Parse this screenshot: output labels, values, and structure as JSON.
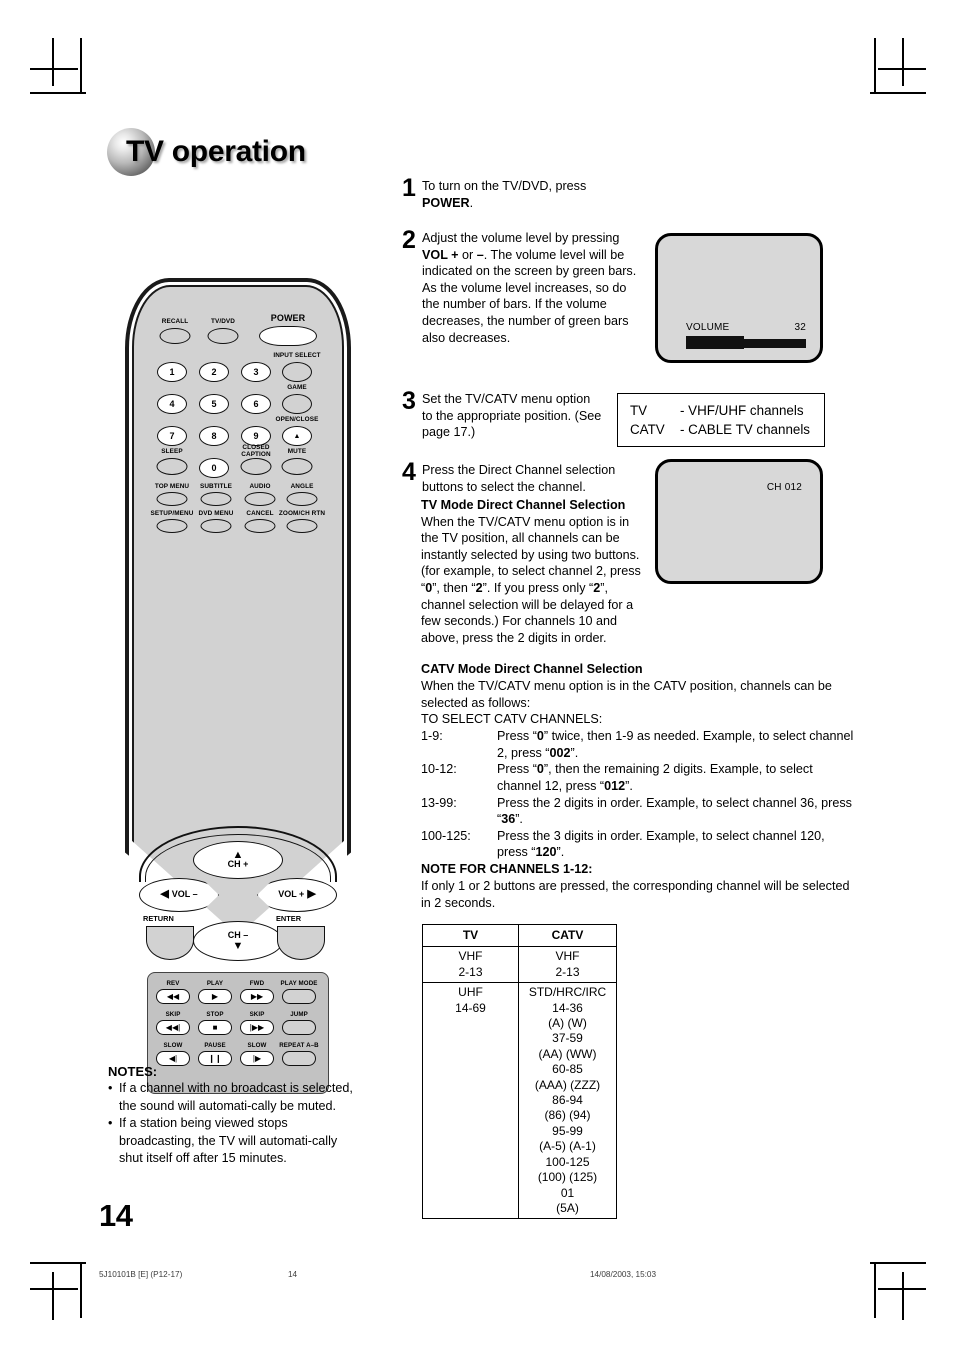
{
  "heading": {
    "ball_text": "TV",
    "title": " operation"
  },
  "remote": {
    "top_labels": [
      {
        "name": "recall",
        "text": "RECALL"
      },
      {
        "name": "tvdvd",
        "text": "TV/DVD"
      },
      {
        "name": "power",
        "text": "POWER"
      }
    ],
    "right_labels": [
      {
        "name": "input-select",
        "text": "INPUT SELECT"
      },
      {
        "name": "game",
        "text": "GAME"
      },
      {
        "name": "open-close",
        "text": "OPEN/CLOSE"
      },
      {
        "name": "mute",
        "text": "MUTE"
      }
    ],
    "numbers": [
      "1",
      "2",
      "3",
      "4",
      "5",
      "6",
      "7",
      "8",
      "9",
      "0"
    ],
    "fn_labels": [
      {
        "name": "sleep",
        "text": "SLEEP"
      },
      {
        "name": "closed-caption",
        "text": "CLOSED\nCAPTION"
      },
      {
        "name": "top-menu",
        "text": "TOP MENU"
      },
      {
        "name": "subtitle",
        "text": "SUBTITLE"
      },
      {
        "name": "audio",
        "text": "AUDIO"
      },
      {
        "name": "angle",
        "text": "ANGLE"
      },
      {
        "name": "setup-menu",
        "text": "SETUP/MENU"
      },
      {
        "name": "dvd-menu",
        "text": "DVD MENU"
      },
      {
        "name": "cancel",
        "text": "CANCEL"
      },
      {
        "name": "zoom-ch-rtn",
        "text": "ZOOM/CH RTN"
      }
    ],
    "dpad": {
      "ch_plus": "CH +",
      "ch_minus": "CH –",
      "vol_minus": "VOL –",
      "vol_plus": "VOL +",
      "return": "RETURN",
      "enter": "ENTER",
      "up_arrow": "▲",
      "down_arrow": "▼",
      "left_arrow": "◀",
      "right_arrow": "▶",
      "eject_glyph": "▲"
    },
    "playback": [
      {
        "label": "REV",
        "glyph": "◀◀"
      },
      {
        "label": "PLAY",
        "glyph": "▶"
      },
      {
        "label": "FWD",
        "glyph": "▶▶"
      },
      {
        "label": "PLAY MODE",
        "glyph": ""
      },
      {
        "label": "SKIP",
        "glyph": "◀◀|"
      },
      {
        "label": "STOP",
        "glyph": "■"
      },
      {
        "label": "SKIP",
        "glyph": "|▶▶"
      },
      {
        "label": "JUMP",
        "glyph": ""
      },
      {
        "label": "SLOW",
        "glyph": "◀|"
      },
      {
        "label": "PAUSE",
        "glyph": "❙❙"
      },
      {
        "label": "SLOW",
        "glyph": "|▶"
      },
      {
        "label": "REPEAT A–B",
        "glyph": ""
      }
    ]
  },
  "steps": {
    "s1": {
      "num": "1",
      "line1": "To turn on the TV/DVD, press ",
      "bold": "POWER",
      "tail": "."
    },
    "s2": {
      "num": "2",
      "p1": "Adjust the volume level by pressing ",
      "b1": "VOL +",
      "p2": " or ",
      "b2": "–",
      "p3": ". The volume level will be indicated on the screen by green bars. As the volume level increases, so do the number of bars. If the volume decreases, the number of green bars also decreases."
    },
    "s3": {
      "num": "3",
      "text": "Set the TV/CATV menu option to the appropriate position. (See page 17.)"
    },
    "s4": {
      "num": "4",
      "text": "Press the Direct Channel selection buttons to select the channel."
    }
  },
  "tv_volume_screen": {
    "label": "VOLUME",
    "value": "32"
  },
  "tv_channel_screen": {
    "label": "CH 012"
  },
  "tvcatv_box": {
    "rows": [
      {
        "key": "TV",
        "value": "- VHF/UHF channels"
      },
      {
        "key": "CATV",
        "value": "- CABLE TV channels"
      }
    ]
  },
  "tv_mode": {
    "title": "TV Mode Direct Channel Selection",
    "p1": "When the TV/CATV menu option is in the TV position, all channels can be instantly selected by using two buttons. (for example, to select channel 2, press “",
    "b1": "0",
    "p2": "”, then “",
    "b2": "2",
    "p3": "”. If you press only “",
    "b3": "2",
    "p4": "”, channel selection will be delayed for a few seconds.) For channels 10 and above, press the 2 digits in order."
  },
  "catv_mode": {
    "title": "CATV Mode Direct Channel Selection",
    "intro": "When the TV/CATV menu option is in the CATV position, channels can be selected as follows:",
    "select_line": "TO SELECT CATV CHANNELS:",
    "rows": [
      {
        "range": "1-9:",
        "pre": "Press “",
        "b1": "0",
        "mid": "” twice, then 1-9 as needed. Example, to select channel 2, press “",
        "b2": "002",
        "post": "”."
      },
      {
        "range": "10-12:",
        "pre": "Press “",
        "b1": "0",
        "mid": "”, then the remaining 2 digits. Example, to select channel 12, press “",
        "b2": "012",
        "post": "”."
      },
      {
        "range": "13-99:",
        "pre": "",
        "b1": "",
        "mid": "Press the 2 digits in order. Example, to select channel 36, press “",
        "b2": "36",
        "post": "”."
      },
      {
        "range": "100-125:",
        "pre": "",
        "b1": "",
        "mid": "Press the 3 digits in order. Example, to select channel 120, press “",
        "b2": "120",
        "post": "”."
      }
    ],
    "note_title": "NOTE FOR CHANNELS 1-12:",
    "note_body": "If only 1 or 2 buttons are pressed, the corresponding channel will be selected in 2 seconds."
  },
  "channel_table": {
    "headers": [
      "TV",
      "CATV"
    ],
    "rows": [
      {
        "tv": "VHF\n2-13",
        "catv": "VHF\n2-13"
      },
      {
        "tv": "UHF\n14-69",
        "catv": "STD/HRC/IRC\n14-36\n(A) (W)\n37-59\n(AA) (WW)\n60-85\n(AAA) (ZZZ)\n86-94\n(86) (94)\n95-99\n(A-5) (A-1)\n100-125\n(100) (125)\n01\n(5A)"
      }
    ]
  },
  "notes": {
    "title": "NOTES:",
    "bullet": "•",
    "items": [
      "If a channel with no broadcast is selected, the sound will automati-cally be muted.",
      "If a station being viewed stops broadcasting, the TV will automati-cally shut itself off after 15 minutes."
    ]
  },
  "page_number": "14",
  "footer": {
    "code": "5J10101B [E] (P12-17)",
    "page": "14",
    "date": "14/08/2003, 15:03"
  }
}
